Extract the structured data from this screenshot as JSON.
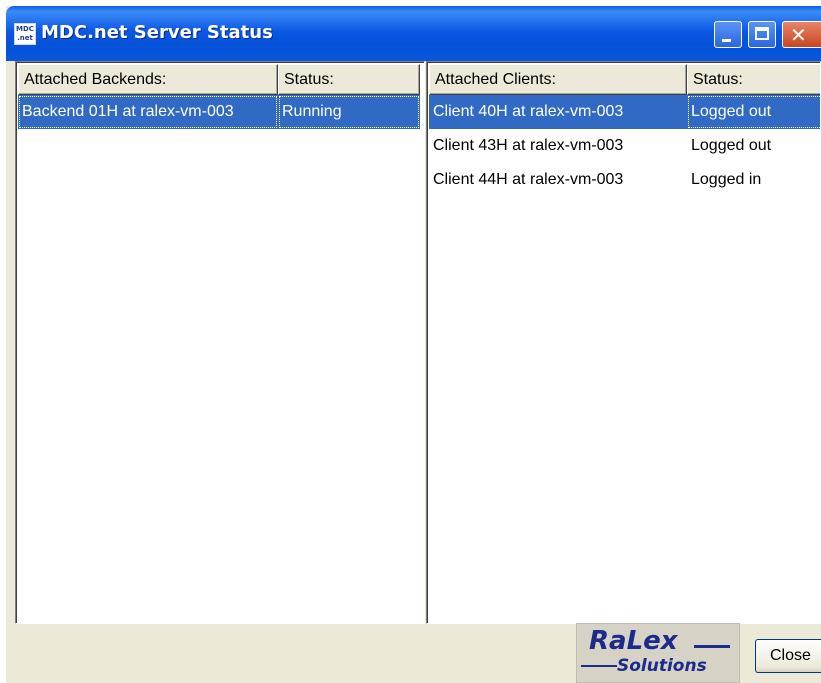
{
  "window": {
    "title": "MDC.net Server Status",
    "icon_text_top": "MDC",
    "icon_text_bottom": ".net"
  },
  "backends": {
    "headers": [
      "Attached Backends:",
      "Status:"
    ],
    "rows": [
      {
        "name": "Backend 01H at ralex-vm-003",
        "status": "Running",
        "selected": true
      }
    ]
  },
  "clients": {
    "headers": [
      "Attached Clients:",
      "Status:"
    ],
    "rows": [
      {
        "name": "Client 40H at ralex-vm-003",
        "status": "Logged out",
        "selected": true
      },
      {
        "name": "Client 43H at ralex-vm-003",
        "status": "Logged out",
        "selected": false
      },
      {
        "name": "Client 44H at ralex-vm-003",
        "status": "Logged in",
        "selected": false
      }
    ]
  },
  "logo": {
    "top": "RaLex",
    "bottom": "Solutions"
  },
  "footer": {
    "close_label": "Close"
  },
  "colors": {
    "selection": "#316ac5",
    "titlebar": "#0a57dd",
    "logo_text": "#1c2a8c"
  }
}
